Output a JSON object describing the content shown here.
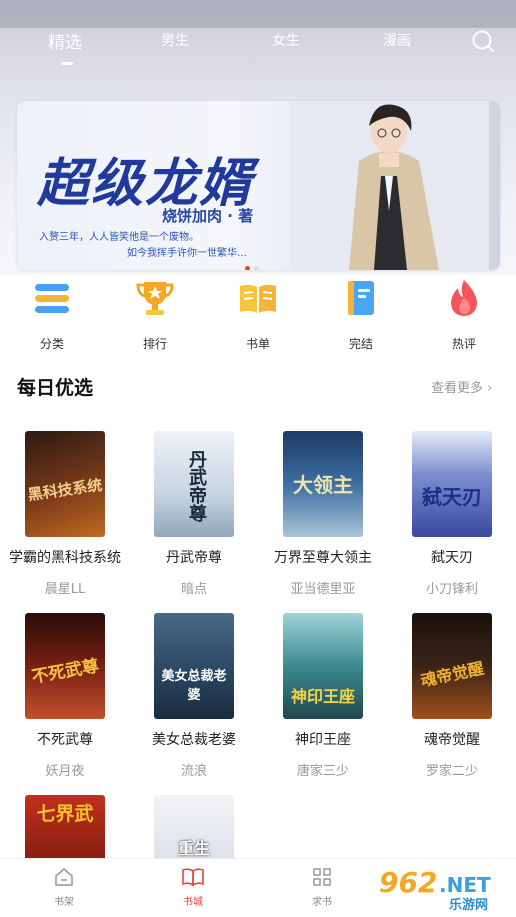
{
  "tabs": [
    "精选",
    "男生",
    "女生",
    "漫画"
  ],
  "banner": {
    "title": "超级龙婿",
    "author": "烧饼加肉 · 著",
    "line1": "入赘三年，人人皆笑他是一个废物。",
    "line2": "如今我挥手许你一世繁华…"
  },
  "categories": [
    {
      "label": "分类",
      "icon": "menu-icon",
      "color": "#4a9ff0"
    },
    {
      "label": "排行",
      "icon": "trophy-icon",
      "color": "#f6a623"
    },
    {
      "label": "书单",
      "icon": "open-book-icon",
      "color": "#f8c53a"
    },
    {
      "label": "完结",
      "icon": "book-icon",
      "color": "#4aa6f3"
    },
    {
      "label": "热评",
      "icon": "flame-icon",
      "color": "#f2555a"
    }
  ],
  "section": {
    "title": "每日优选",
    "more": "查看更多 ›"
  },
  "books": [
    {
      "title": "学霸的黑科技系统",
      "author": "晨星LL",
      "cover_text": "黑科技系统",
      "bg": "#5a2f1c",
      "accent": "#f5d08a"
    },
    {
      "title": "丹武帝尊",
      "author": "暗点",
      "cover_text": "丹武帝尊",
      "bg": "#dfe6ee",
      "accent": "#1a2a3a"
    },
    {
      "title": "万界至尊大领主",
      "author": "亚当德里亚",
      "cover_text": "大领主",
      "bg": "#2b4f7a",
      "accent": "#f1e3b0"
    },
    {
      "title": "弑天刃",
      "author": "小刀锋利",
      "cover_text": "弑天刃",
      "bg": "#4654a8",
      "accent": "#e9ecff"
    },
    {
      "title": "不死武尊",
      "author": "妖月夜",
      "cover_text": "不死武尊",
      "bg": "#5a1612",
      "accent": "#f5c542"
    },
    {
      "title": "美女总裁老婆",
      "author": "流浪",
      "cover_text": "美女总裁老婆",
      "bg": "#2d4a66",
      "accent": "#ffffff"
    },
    {
      "title": "神印王座",
      "author": "唐家三少",
      "cover_text": "神印王座",
      "bg": "#2f6d74",
      "accent": "#f7d34b"
    },
    {
      "title": "魂帝觉醒",
      "author": "罗家二少",
      "cover_text": "魂帝觉醒",
      "bg": "#2a1a14",
      "accent": "#f0b030"
    },
    {
      "title": "",
      "author": "",
      "cover_text": "七界武",
      "bg": "#8a1f12",
      "accent": "#f4c030"
    },
    {
      "title": "",
      "author": "",
      "cover_text": "重生",
      "bg": "#d8dce4",
      "accent": "#ffffff"
    }
  ],
  "bottom_nav": [
    "书架",
    "书城",
    "求书",
    ""
  ],
  "watermark": "962.NET 乐游网"
}
